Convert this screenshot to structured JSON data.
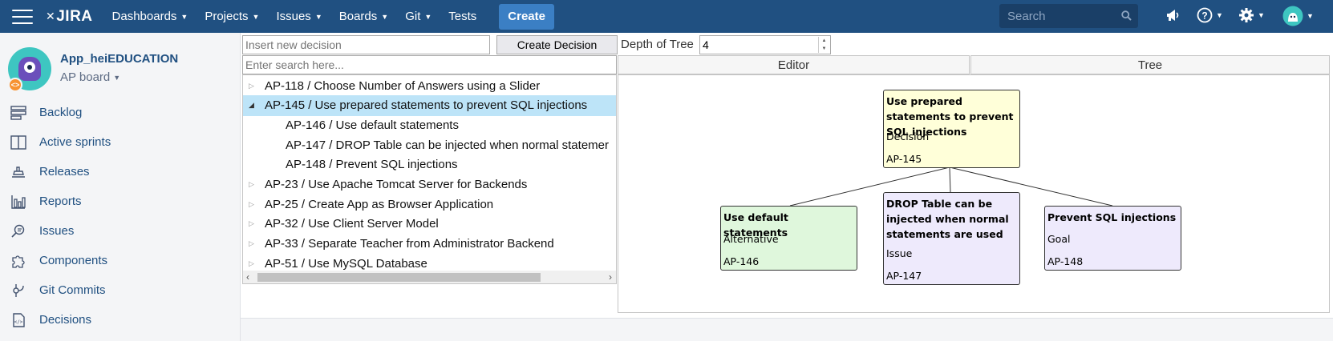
{
  "header": {
    "logo": "JIRA",
    "nav": [
      {
        "label": "Dashboards"
      },
      {
        "label": "Projects"
      },
      {
        "label": "Issues"
      },
      {
        "label": "Boards"
      },
      {
        "label": "Git"
      },
      {
        "label": "Tests"
      }
    ],
    "create_label": "Create",
    "search_placeholder": "Search"
  },
  "sidebar": {
    "project_name": "App_heiEDUCATION",
    "board_name": "AP board",
    "items": [
      {
        "label": "Backlog",
        "icon": "backlog-icon"
      },
      {
        "label": "Active sprints",
        "icon": "active-sprints-icon"
      },
      {
        "label": "Releases",
        "icon": "releases-icon"
      },
      {
        "label": "Reports",
        "icon": "reports-icon"
      },
      {
        "label": "Issues",
        "icon": "issues-icon"
      },
      {
        "label": "Components",
        "icon": "components-icon"
      },
      {
        "label": "Git Commits",
        "icon": "git-commits-icon"
      },
      {
        "label": "Decisions",
        "icon": "decisions-icon"
      }
    ]
  },
  "toolbar": {
    "new_decision_placeholder": "Insert new decision",
    "create_decision_label": "Create Decision",
    "depth_label": "Depth of Tree",
    "depth_value": "4",
    "search_placeholder": "Enter search here..."
  },
  "tabs": {
    "editor": "Editor",
    "tree": "Tree"
  },
  "tree_items": [
    {
      "label": "AP-118 / Choose Number of Answers using a Slider",
      "level": 0,
      "expanded": false,
      "selected": false
    },
    {
      "label": "AP-145 / Use prepared statements to prevent SQL injections",
      "level": 0,
      "expanded": true,
      "selected": true
    },
    {
      "label": "AP-146 / Use default statements",
      "level": 1,
      "expanded": false,
      "selected": false
    },
    {
      "label": "AP-147 / DROP Table can be injected when normal statemer",
      "level": 1,
      "expanded": false,
      "selected": false
    },
    {
      "label": "AP-148 / Prevent SQL injections",
      "level": 1,
      "expanded": false,
      "selected": false
    },
    {
      "label": "AP-23 / Use Apache Tomcat Server for Backends",
      "level": 0,
      "expanded": false,
      "selected": false
    },
    {
      "label": "AP-25 / Create App as Browser Application",
      "level": 0,
      "expanded": false,
      "selected": false
    },
    {
      "label": "AP-32 / Use Client Server Model",
      "level": 0,
      "expanded": false,
      "selected": false
    },
    {
      "label": "AP-33 / Separate Teacher from Administrator Backend",
      "level": 0,
      "expanded": false,
      "selected": false
    },
    {
      "label": "AP-51 / Use MySQL Database",
      "level": 0,
      "expanded": false,
      "selected": false
    }
  ],
  "graph": {
    "root": {
      "title": "Use prepared statements to prevent SQL injections",
      "kind": "Decision",
      "key": "AP-145",
      "color": "#ffffd9"
    },
    "children": [
      {
        "title": "Use default statements",
        "kind": "Alternative",
        "key": "AP-146",
        "color": "#dff7dc"
      },
      {
        "title": "DROP Table can be injected when normal statements are used",
        "kind": "Issue",
        "key": "AP-147",
        "color": "#eeeafc"
      },
      {
        "title": "Prevent SQL injections",
        "kind": "Goal",
        "key": "AP-148",
        "color": "#eeeafc"
      }
    ]
  },
  "colors": {
    "header_bg": "#205081",
    "create_button": "#3b7fc4",
    "link": "#205081",
    "selected_row": "#bde4f8"
  }
}
